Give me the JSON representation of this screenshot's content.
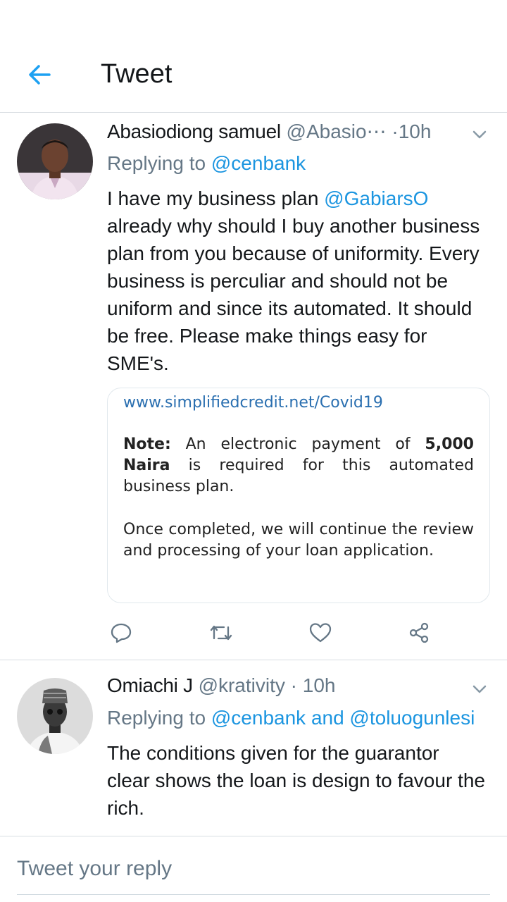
{
  "header": {
    "title": "Tweet"
  },
  "tweets": [
    {
      "name": "Abasiodiong samuel",
      "handle": "@Abasio⋯",
      "separator": "·",
      "time": "10h",
      "replying_prefix": "Replying to",
      "replying_to": "@cenbank",
      "text_before_mention": "I have my business plan ",
      "text_mention": "@GabiarsO",
      "text_after_mention": " already why should I buy another business plan from you because of uniformity. Every business is perculiar and should not be uniform and since its automated. It should be free.  Please make things easy for SME's.",
      "media": {
        "url": "www.simplifiedcredit.net/Covid19",
        "note_label": "Note:",
        "note_text_1": " An electronic payment of ",
        "note_amount": "5,000 Naira",
        "note_text_2": " is required for this automated business plan.",
        "paragraph_2": "Once completed, we will continue the review and processing of your loan application."
      }
    },
    {
      "name": "Omiachi J",
      "handle": "@krativity",
      "separator": "·",
      "time": "10h",
      "replying_prefix": "Replying to",
      "replying_to": "@cenbank and @toluogunlesi",
      "text": "The conditions given for the guarantor clear shows the loan is design to favour the rich."
    }
  ],
  "reply_box": {
    "placeholder": "Tweet your reply"
  },
  "colors": {
    "accent": "#1da1f2",
    "link": "#1b95e0",
    "secondary_text": "#657786",
    "divider": "#d8dde2"
  }
}
